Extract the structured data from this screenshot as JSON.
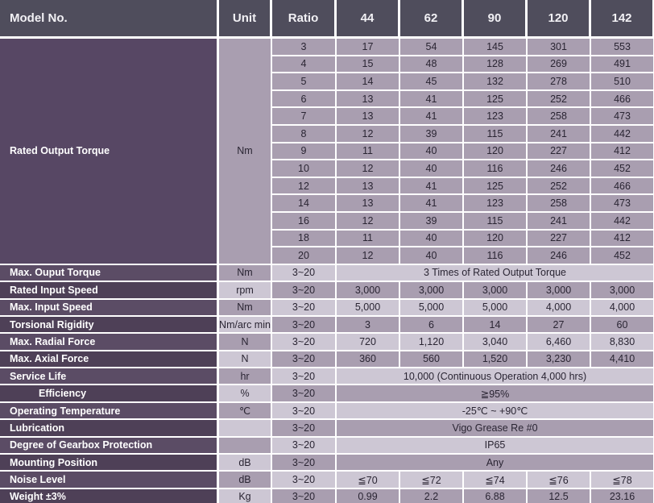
{
  "table": {
    "header": {
      "model_label": "Model No.",
      "unit_label": "Unit",
      "ratio_label": "Ratio",
      "models": [
        "44",
        "62",
        "90",
        "120",
        "142"
      ]
    },
    "rated_output_torque": {
      "label": "Rated Output Torque",
      "unit": "Nm",
      "ratios": [
        "3",
        "4",
        "5",
        "6",
        "7",
        "8",
        "9",
        "10",
        "12",
        "14",
        "16",
        "18",
        "20"
      ],
      "rows": [
        [
          "17",
          "54",
          "145",
          "301",
          "553"
        ],
        [
          "15",
          "48",
          "128",
          "269",
          "491"
        ],
        [
          "14",
          "45",
          "132",
          "278",
          "510"
        ],
        [
          "13",
          "41",
          "125",
          "252",
          "466"
        ],
        [
          "13",
          "41",
          "123",
          "258",
          "473"
        ],
        [
          "12",
          "39",
          "115",
          "241",
          "442"
        ],
        [
          "11",
          "40",
          "120",
          "227",
          "412"
        ],
        [
          "12",
          "40",
          "116",
          "246",
          "452"
        ],
        [
          "13",
          "41",
          "125",
          "252",
          "466"
        ],
        [
          "13",
          "41",
          "123",
          "258",
          "473"
        ],
        [
          "12",
          "39",
          "115",
          "241",
          "442"
        ],
        [
          "11",
          "40",
          "120",
          "227",
          "412"
        ],
        [
          "12",
          "40",
          "116",
          "246",
          "452"
        ]
      ]
    },
    "spec_rows": [
      {
        "label": "Max. Ouput Torque",
        "unit": "Nm",
        "ratio": "3~20",
        "merged": true,
        "merged_value": "3 Times of Rated Output Torque"
      },
      {
        "label": "Rated Input Speed",
        "unit": "rpm",
        "ratio": "3~20",
        "merged": false,
        "values": [
          "3,000",
          "3,000",
          "3,000",
          "3,000",
          "3,000"
        ]
      },
      {
        "label": "Max. Input Speed",
        "unit": "Nm",
        "ratio": "3~20",
        "merged": false,
        "values": [
          "5,000",
          "5,000",
          "5,000",
          "4,000",
          "4,000"
        ]
      },
      {
        "label": "Torsional Rigidity",
        "unit": "Nm/arc min",
        "ratio": "3~20",
        "merged": false,
        "values": [
          "3",
          "6",
          "14",
          "27",
          "60"
        ]
      },
      {
        "label": "Max. Radial Force",
        "unit": "N",
        "ratio": "3~20",
        "merged": false,
        "values": [
          "720",
          "1,120",
          "3,040",
          "6,460",
          "8,830"
        ]
      },
      {
        "label": "Max. Axial Force",
        "unit": "N",
        "ratio": "3~20",
        "merged": false,
        "values": [
          "360",
          "560",
          "1,520",
          "3,230",
          "4,410"
        ]
      },
      {
        "label": "Service Life",
        "unit": "hr",
        "ratio": "3~20",
        "merged": true,
        "merged_value": "10,000 (Continuous Operation 4,000 hrs)"
      },
      {
        "label": "Efficiency",
        "unit": "%",
        "ratio": "3~20",
        "merged": true,
        "merged_value": "≧95%",
        "indent": true
      },
      {
        "label": "Operating Temperature",
        "unit": "℃",
        "ratio": "3~20",
        "merged": true,
        "merged_value": "-25℃ ~ +90℃"
      },
      {
        "label": "Lubrication",
        "unit": "",
        "ratio": "3~20",
        "merged": true,
        "merged_value": "Vigo Grease Re #0"
      },
      {
        "label": "Degree of Gearbox Protection",
        "unit": "",
        "ratio": "3~20",
        "merged": true,
        "merged_value": "IP65"
      },
      {
        "label": "Mounting Position",
        "unit": "dB",
        "ratio": "3~20",
        "merged": true,
        "merged_value": "Any"
      },
      {
        "label": "Noise Level",
        "unit": "dB",
        "ratio": "3~20",
        "merged": false,
        "values": [
          "≦70",
          "≦72",
          "≦74",
          "≦76",
          "≦78"
        ]
      },
      {
        "label": "Weight ±3%",
        "unit": "Kg",
        "ratio": "3~20",
        "merged": false,
        "values": [
          "0.99",
          "2.2",
          "6.88",
          "12.5",
          "23.16"
        ]
      }
    ]
  },
  "colors": {
    "header_bg": "#4f4d5c",
    "header_text": "#f2f1f5",
    "label_dark": "#4e4057",
    "label_light": "#5b4c65",
    "label_block": "#574764",
    "data_dark": "#a99eb0",
    "data_light": "#cdc7d4",
    "grid_line": "#ffffff",
    "data_text": "#2a2533"
  }
}
